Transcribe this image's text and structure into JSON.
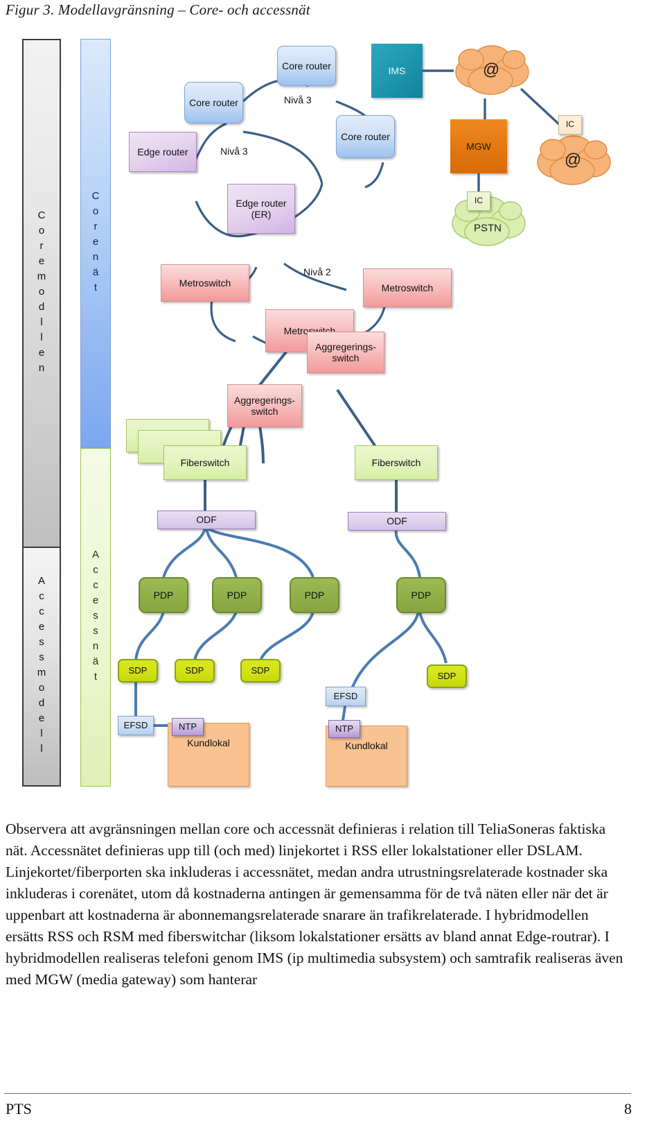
{
  "figure": {
    "title": "Figur 3. Modellavgränsning – Core- och accessnät"
  },
  "bars": {
    "core_model": "Coremodllen",
    "access_model": "Accessmodell",
    "core_net": "Corenät",
    "access_net": "Accessnät"
  },
  "labels": {
    "niva3_a": "Nivå 3",
    "niva3_b": "Nivå 3",
    "niva2": "Nivå 2"
  },
  "nodes": {
    "core_router_1": "Core router",
    "core_router_2": "Core router",
    "core_router_3": "Core router",
    "edge_router_1": "Edge router",
    "edge_router_2": "Edge router (ER)",
    "ims": "IMS",
    "mgw": "MGW",
    "ic_internet": "IC",
    "ic_pstn": "IC",
    "cloud_internet_1": "@",
    "cloud_internet_2": "@",
    "cloud_pstn": "PSTN",
    "metroswitch_1": "Metroswitch",
    "metroswitch_2": "Metroswitch",
    "metroswitch_3": "Metroswitch",
    "agg_switch_1": "Aggregerings- switch",
    "agg_switch_2": "Aggregerings- switch",
    "fiberswitch_1": "Fiberswitch",
    "fiberswitch_2": "Fiberswitch",
    "odf_1": "ODF",
    "odf_2": "ODF",
    "pdp_1": "PDP",
    "pdp_2": "PDP",
    "pdp_3": "PDP",
    "pdp_4": "PDP",
    "sdp_1": "SDP",
    "sdp_2": "SDP",
    "sdp_3": "SDP",
    "sdp_4": "SDP",
    "efsd_1": "EFSD",
    "efsd_2": "EFSD",
    "ntp_1": "NTP",
    "ntp_2": "NTP",
    "kundlokal_1": "Kundlokal",
    "kundlokal_2": "Kundlokal"
  },
  "body": {
    "paragraph": "Observera att avgränsningen mellan core och accessnät definieras i relation till TeliaSoneras faktiska nät. Accessnätet definieras upp till (och med) linjekortet i RSS eller lokalstationer eller DSLAM. Linjekortet/fiberporten ska inkluderas i accessnätet, medan andra utrustningsrelaterade kostnader ska inkluderas i corenätet, utom då kostnaderna antingen är gemensamma för de två näten eller när det är uppenbart att kostnaderna är abonnemangsrelaterade snarare än trafikrelaterade. I hybridmodellen ersätts RSS och RSM med fiberswitchar (liksom lokalstationer ersätts av bland annat Edge-routrar). I hybridmodellen realiseras telefoni genom IMS (ip multimedia subsystem) och samtrafik realiseras även med MGW (media gateway) som hanterar"
  },
  "footer": {
    "left": "PTS",
    "page": "8"
  },
  "colors": {
    "wire": "#3b5f87",
    "core_bar": "#9dc2ef",
    "access_bar": "#e1f1c4",
    "metro": "#f7b9b9",
    "pdp": "#8fae48",
    "sdp": "#cfe015",
    "ims": "#1b93ab",
    "mgw": "#e2760f",
    "cloud_orange": "#f7b377",
    "cloud_green": "#d9eeb0"
  }
}
